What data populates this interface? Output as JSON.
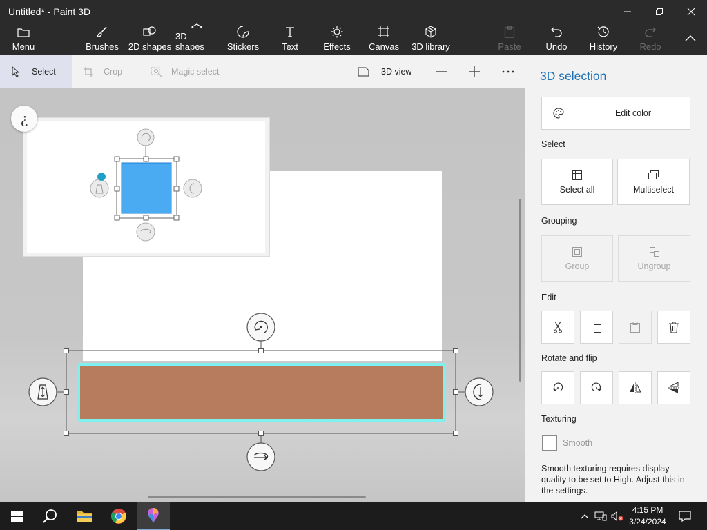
{
  "window": {
    "title": "Untitled* - Paint 3D"
  },
  "ribbon": {
    "menu": "Menu",
    "brushes": "Brushes",
    "shapes_2d": "2D shapes",
    "shapes_3d": "3D shapes",
    "stickers": "Stickers",
    "text": "Text",
    "effects": "Effects",
    "canvas": "Canvas",
    "library_3d": "3D library",
    "paste": "Paste",
    "undo": "Undo",
    "history": "History",
    "redo": "Redo"
  },
  "toolbar": {
    "select": "Select",
    "crop": "Crop",
    "magic_select": "Magic select",
    "view_3d": "3D view"
  },
  "workspace": {
    "help": "¿",
    "object_color": "#B77C5E",
    "thumb_object_color": "#4AABF2",
    "outline_color": "#7FF0F0"
  },
  "panel": {
    "title": "3D selection",
    "edit_color": "Edit color",
    "select_label": "Select",
    "select_all": "Select all",
    "multiselect": "Multiselect",
    "grouping_label": "Grouping",
    "group": "Group",
    "ungroup": "Ungroup",
    "edit_label": "Edit",
    "rotate_label": "Rotate and flip",
    "texturing_label": "Texturing",
    "smooth": "Smooth",
    "smooth_checked": false,
    "smooth_note": "Smooth texturing requires display quality to be set to High. Adjust this in the settings."
  },
  "taskbar": {
    "time": "4:15 PM",
    "date": "3/24/2024"
  }
}
